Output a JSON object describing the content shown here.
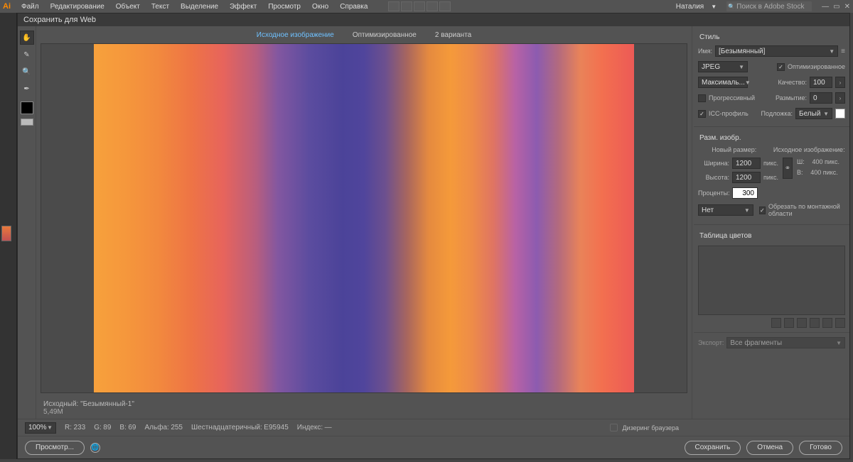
{
  "menubar": {
    "items": [
      "Файл",
      "Редактирование",
      "Объект",
      "Текст",
      "Выделение",
      "Эффект",
      "Просмотр",
      "Окно",
      "Справка"
    ],
    "user": "Наталия",
    "search_placeholder": "Поиск в Adobe Stock"
  },
  "dialog": {
    "title": "Сохранить для Web",
    "tabs": [
      "Исходное изображение",
      "Оптимизированное",
      "2 варианта"
    ],
    "active_tab": 0
  },
  "canvas_info": {
    "line1": "Исходный: \"Безымянный-1\"",
    "line2": "5,49M"
  },
  "settings": {
    "preset_heading": "Стиль",
    "name_label": "Имя:",
    "name_value": "[Безымянный]",
    "format": "JPEG",
    "optimized_label": "Оптимизированное",
    "optimized": true,
    "quality_preset": "Максималь...",
    "quality_label": "Качество:",
    "quality_value": "100",
    "progressive_label": "Прогрессивный",
    "progressive": false,
    "blur_label": "Размытие:",
    "blur_value": "0",
    "icc_label": "ICC-профиль",
    "icc": true,
    "matte_label": "Подложка:",
    "matte_value": "Белый"
  },
  "image_size": {
    "heading": "Разм. изобр.",
    "new_size_label": "Новый размер:",
    "source_image_label": "Исходное изображение:",
    "width_label": "Ширина:",
    "height_label": "Высота:",
    "width_value": "1200",
    "height_value": "1200",
    "px": "пикс.",
    "src_w_label": "Ш:",
    "src_w_value": "400 пикс.",
    "src_h_label": "В:",
    "src_h_value": "400 пикс.",
    "percent_label": "Проценты:",
    "percent_value": "300",
    "interpolation": "Нет",
    "clip_artboard_label": "Обрезать по монтажной области",
    "clip_artboard": true
  },
  "color_table": {
    "heading": "Таблица цветов"
  },
  "export": {
    "label": "Экспорт:",
    "value": "Все фрагменты"
  },
  "status": {
    "zoom": "100%",
    "r_label": "R:",
    "r": "233",
    "g_label": "G:",
    "g": "89",
    "b_label": "B:",
    "b": "69",
    "alpha_label": "Альфа:",
    "alpha": "255",
    "hex_label": "Шестнадцатеричный:",
    "hex": "E95945",
    "index_label": "Индекс:",
    "index": "—",
    "browser_dither": "Дизеринг браузера"
  },
  "footer": {
    "preview": "Просмотр...",
    "save": "Сохранить",
    "cancel": "Отмена",
    "done": "Готово"
  }
}
